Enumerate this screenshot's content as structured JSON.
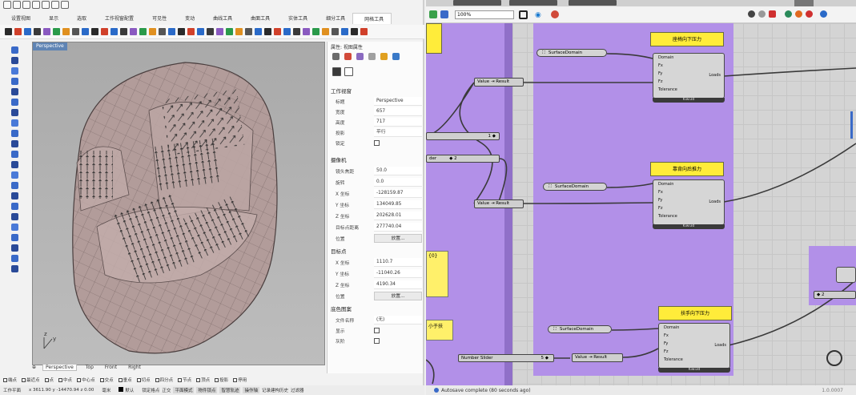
{
  "rhino": {
    "menu_tabs": [
      "设置视图",
      "显示",
      "选取",
      "工作视窗配置",
      "可见性",
      "变动",
      "曲线工具",
      "曲面工具",
      "实体工具",
      "细分工具",
      "网格工具"
    ],
    "viewport": {
      "title": "Perspective",
      "bottom_tabs": [
        "Perspective",
        "Top",
        "Front",
        "Right"
      ],
      "axis_labels": {
        "z": "z",
        "y": "y"
      }
    },
    "properties": {
      "header": "属性: 视图属性",
      "section_workview": "工作视窗",
      "rows_view": [
        {
          "label": "标题",
          "value": "Perspective"
        },
        {
          "label": "宽度",
          "value": "657"
        },
        {
          "label": "高度",
          "value": "717"
        },
        {
          "label": "投影",
          "value": "平行"
        },
        {
          "label": "锁定",
          "value": ""
        }
      ],
      "section_camera": "摄像机",
      "rows_camera": [
        {
          "label": "镜头焦距",
          "value": "50.0"
        },
        {
          "label": "旋转",
          "value": "0.0"
        },
        {
          "label": "X 坐标",
          "value": "-128159.87"
        },
        {
          "label": "Y 坐标",
          "value": "134049.85"
        },
        {
          "label": "Z 坐标",
          "value": "202628.01"
        },
        {
          "label": "目标点距离",
          "value": "277740.04"
        },
        {
          "label": "位置",
          "value": "放置..."
        }
      ],
      "section_target": "目标点",
      "rows_target": [
        {
          "label": "X 坐标",
          "value": "1110.7"
        },
        {
          "label": "Y 坐标",
          "value": "-11040.26"
        },
        {
          "label": "Z 坐标",
          "value": "4190.34"
        },
        {
          "label": "位置",
          "value": "放置..."
        }
      ],
      "section_background": "底色图案",
      "rows_background": [
        {
          "label": "文件名称",
          "value": "(无)"
        },
        {
          "label": "显示",
          "value": ""
        },
        {
          "label": "灰阶",
          "value": ""
        }
      ]
    },
    "snap_bar": [
      "端点",
      "最近点",
      "点",
      "中点",
      "中心点",
      "交点",
      "垂点",
      "切点",
      "四分点",
      "节点",
      "顶点",
      "投影",
      "停用"
    ],
    "status_bar": {
      "plane": "工作平面",
      "coords": "x 3611.90  y -14470.94  z 0.00",
      "unit": "毫米",
      "layer": "默认",
      "toggles": [
        "锁定格点",
        "正交",
        "平面模式",
        "物件锁点",
        "智慧轨迹",
        "操作轴",
        "记录建构历史",
        "过滤器"
      ]
    }
  },
  "grasshopper": {
    "zoom": "100%",
    "status": "Autosave complete (80 seconds ago)",
    "version": "1.0.0007",
    "components": [
      {
        "title": "座椅向下压力",
        "surface_label": "SurfaceDomain",
        "value_label": "Value",
        "value_output": "Result",
        "inputs": [
          "Domain",
          "Fx",
          "Fy",
          "Fz",
          "Tolerance"
        ],
        "output": "Loads",
        "footer": "Kiwi3d"
      },
      {
        "title": "靠背向后推力",
        "surface_label": "SurfaceDomain",
        "value_label": "Value",
        "value_output": "Result",
        "inputs": [
          "Domain",
          "Fx",
          "Fy",
          "Fz",
          "Tolerance"
        ],
        "output": "Loads",
        "footer": "Kiwi3d"
      },
      {
        "title": "扶手向下压力",
        "surface_label": "SurfaceDomain",
        "value_label": "Value",
        "value_output": "Result",
        "inputs": [
          "Domain",
          "Fx",
          "Fy",
          "Fz",
          "Tolerance"
        ],
        "output": "Loads",
        "footer": "Kiwi3d"
      }
    ],
    "slider1_value": "1 ◆",
    "slider2_label": "der",
    "slider2_value": "◆ 2",
    "slider3_label": "Number Slider",
    "slider3_value": "5 ◆",
    "yellow_panel_text": "{0}",
    "yellow_panel2_text": "小于扶",
    "right_box_value": "◆ 2"
  }
}
